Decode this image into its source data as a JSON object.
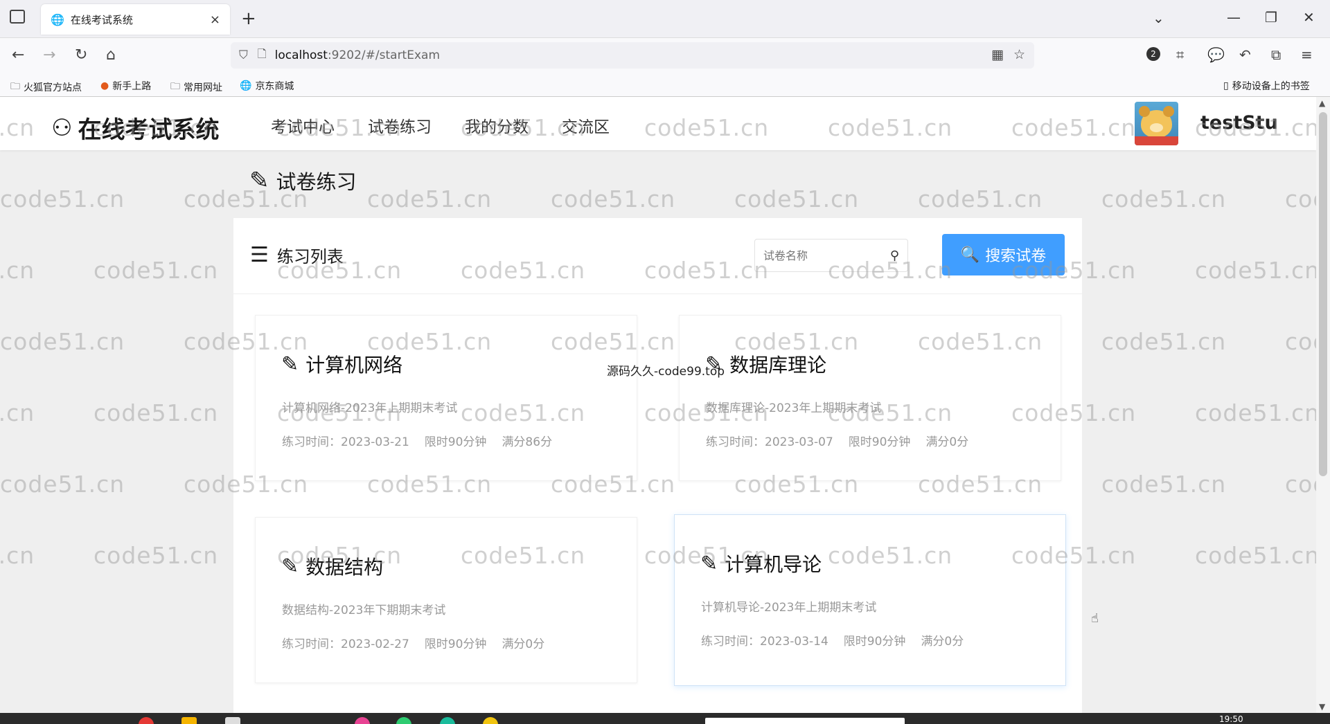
{
  "browser": {
    "tab_title": "在线考试系统",
    "url_host": "localhost",
    "url_rest": ":9202/#/startExam",
    "extension_badge": "2",
    "bookmarks": [
      "火狐官方站点",
      "新手上路",
      "常用网址",
      "京东商城"
    ],
    "mobile_bookmarks": "移动设备上的书签"
  },
  "site": {
    "logo_text": "在线考试系统",
    "menu": [
      "考试中心",
      "试卷练习",
      "我的分数",
      "交流区"
    ],
    "username": "testStu"
  },
  "page": {
    "section_title": "试卷练习",
    "list_title": "练习列表",
    "search_placeholder": "试卷名称",
    "search_button": "搜索试卷",
    "source_note": "源码久久-code99.top"
  },
  "cards": [
    {
      "title": "计算机网络",
      "desc": "计算机网络-2023年上期期末考试",
      "date": "练习时间：2023-03-21",
      "limit": "限时90分钟",
      "score": "满分86分"
    },
    {
      "title": "数据库理论",
      "desc": "数据库理论-2023年上期期末考试",
      "date": "练习时间：2023-03-07",
      "limit": "限时90分钟",
      "score": "满分0分"
    },
    {
      "title": "数据结构",
      "desc": "数据结构-2023年下期期末考试",
      "date": "练习时间：2023-02-27",
      "limit": "限时90分钟",
      "score": "满分0分"
    },
    {
      "title": "计算机导论",
      "desc": "计算机导论-2023年上期期末考试",
      "date": "练习时间：2023-03-14",
      "limit": "限时90分钟",
      "score": "满分0分"
    }
  ],
  "watermark_text": "code51.cn",
  "taskbar": {
    "clock": "19:50"
  },
  "colors": {
    "primary": "#409eff",
    "muted_text": "#999999"
  }
}
